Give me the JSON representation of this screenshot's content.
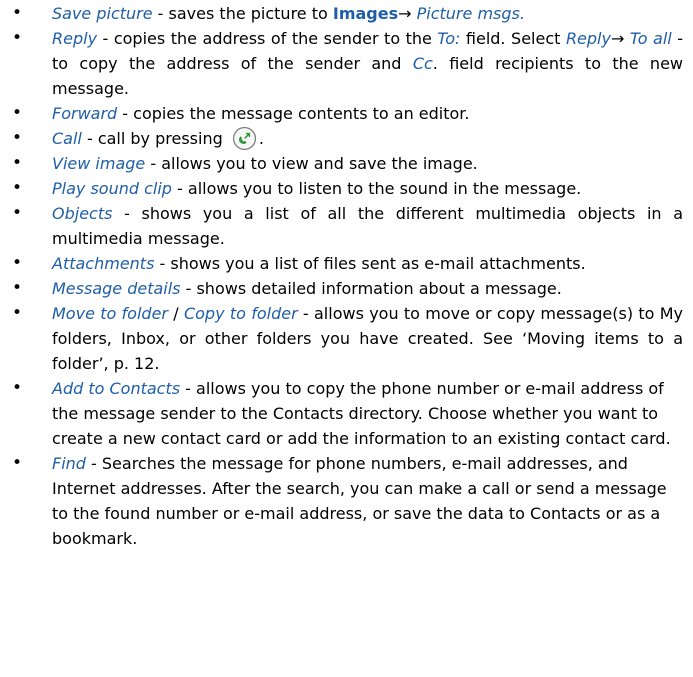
{
  "items": [
    {
      "parts": [
        {
          "s": "t",
          "v": "Save picture"
        },
        {
          "s": "n",
          "v": " - saves the picture to "
        },
        {
          "s": "b",
          "v": "Images"
        },
        {
          "s": "n",
          "v": "→ "
        },
        {
          "s": "t",
          "v": "Picture msgs."
        }
      ]
    },
    {
      "parts": [
        {
          "s": "t",
          "v": "Reply"
        },
        {
          "s": "n",
          "v": " - copies the address of the sender to the "
        },
        {
          "s": "t",
          "v": "To:"
        },
        {
          "s": "n",
          "v": " field. Select "
        },
        {
          "s": "t",
          "v": "Reply"
        },
        {
          "s": "n",
          "v": "→ "
        },
        {
          "s": "t",
          "v": "To all"
        },
        {
          "s": "n",
          "v": " - to copy the address of the sender and "
        },
        {
          "s": "t",
          "v": "Cc"
        },
        {
          "s": "n",
          "v": ". field recipients to the new message."
        }
      ]
    },
    {
      "parts": [
        {
          "s": "t",
          "v": "Forward"
        },
        {
          "s": "n",
          "v": " - copies the message contents to an editor."
        }
      ]
    },
    {
      "parts": [
        {
          "s": "t",
          "v": "Call"
        },
        {
          "s": "n",
          "v": " - call by pressing "
        },
        {
          "s": "icon",
          "v": "call-key-icon"
        },
        {
          "s": "n",
          "v": "."
        }
      ]
    },
    {
      "parts": [
        {
          "s": "t",
          "v": "View image"
        },
        {
          "s": "n",
          "v": " - allows you to view and save the image."
        }
      ]
    },
    {
      "parts": [
        {
          "s": "t",
          "v": "Play sound clip"
        },
        {
          "s": "n",
          "v": " - allows you to listen to the sound in the message."
        }
      ]
    },
    {
      "parts": [
        {
          "s": "t",
          "v": "Objects"
        },
        {
          "s": "n",
          "v": " - shows you a list of all the different multimedia objects in a multimedia message."
        }
      ]
    },
    {
      "parts": [
        {
          "s": "t",
          "v": "Attachments"
        },
        {
          "s": "n",
          "v": " - shows you a list of files sent as e-mail attachments."
        }
      ]
    },
    {
      "parts": [
        {
          "s": "t",
          "v": "Message details"
        },
        {
          "s": "n",
          "v": " - shows detailed information about a message."
        }
      ]
    },
    {
      "parts": [
        {
          "s": "t",
          "v": "Move to folder"
        },
        {
          "s": "n",
          "v": " / "
        },
        {
          "s": "t",
          "v": "Copy to folder"
        },
        {
          "s": "n",
          "v": " - allows you to move or copy message(s) to My folders, Inbox, or other folders you have created. See ‘Moving items to a folder’, p. 12."
        }
      ]
    },
    {
      "left": true,
      "parts": [
        {
          "s": "t",
          "v": "Add to Contacts"
        },
        {
          "s": "n",
          "v": " - allows you to copy the phone number or e-mail address of the message sender to the Contacts directory. Choose whether you want to create a new contact card or add the information to an existing contact card."
        }
      ]
    },
    {
      "left": true,
      "parts": [
        {
          "s": "t",
          "v": "Find"
        },
        {
          "s": "n",
          "v": " - Searches the message for phone numbers, e-mail addresses, and Internet addresses. After the search, you can make a call or send a message to the found number or e-mail address, or save the data to Contacts or as a bookmark."
        }
      ]
    }
  ],
  "bullet_char": "•",
  "colors": {
    "term": "#1f5ea8",
    "text": "#000000",
    "call_icon": "#2e9a3a"
  }
}
